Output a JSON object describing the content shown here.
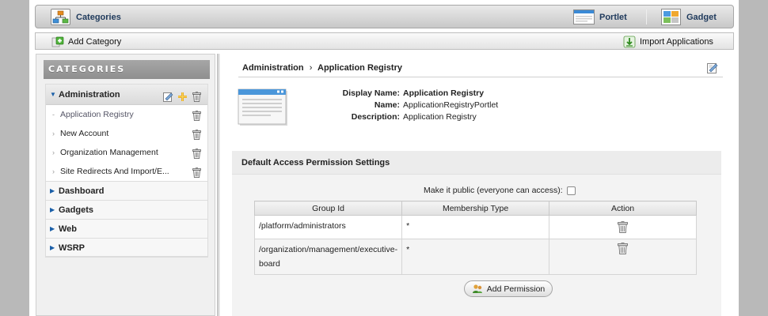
{
  "toolbar": {
    "categories_label": "Categories",
    "portlet_label": "Portlet",
    "gadget_label": "Gadget"
  },
  "actions": {
    "add_category_label": "Add Category",
    "import_applications_label": "Import Applications"
  },
  "sidebar": {
    "header": "CATEGORIES",
    "expanded_category": "Administration",
    "children": [
      {
        "label": "Application Registry",
        "selected": true
      },
      {
        "label": "New Account"
      },
      {
        "label": "Organization Management"
      },
      {
        "label": "Site Redirects And Import/E..."
      }
    ],
    "categories": [
      "Dashboard",
      "Gadgets",
      "Web",
      "WSRP"
    ]
  },
  "breadcrumb": {
    "parent": "Administration",
    "separator": "›",
    "current": "Application Registry"
  },
  "details": {
    "display_name_label": "Display Name:",
    "display_name": "Application Registry",
    "name_label": "Name:",
    "name": "ApplicationRegistryPortlet",
    "description_label": "Description:",
    "description": "Application Registry"
  },
  "permissions": {
    "title": "Default Access Permission Settings",
    "public_label": "Make it public (everyone can access):",
    "public_checked": false,
    "columns": [
      "Group Id",
      "Membership Type",
      "Action"
    ],
    "rows": [
      {
        "group": "/platform/administrators",
        "membership": "*"
      },
      {
        "group": "/organization/management/executive-board",
        "membership": "*"
      }
    ],
    "add_permission_label": "Add Permission"
  },
  "icons": {
    "categories": "categories-icon",
    "portlet": "portlet-icon",
    "gadget": "gadget-icon",
    "add_category": "add-category-icon",
    "import": "import-icon",
    "edit": "edit-icon",
    "add": "add-icon",
    "trash": "trash-icon"
  },
  "colors": {
    "header_text": "#1f3a5c",
    "expand_arrow": "#1a5fa8",
    "category_header_bg": "#999999"
  }
}
